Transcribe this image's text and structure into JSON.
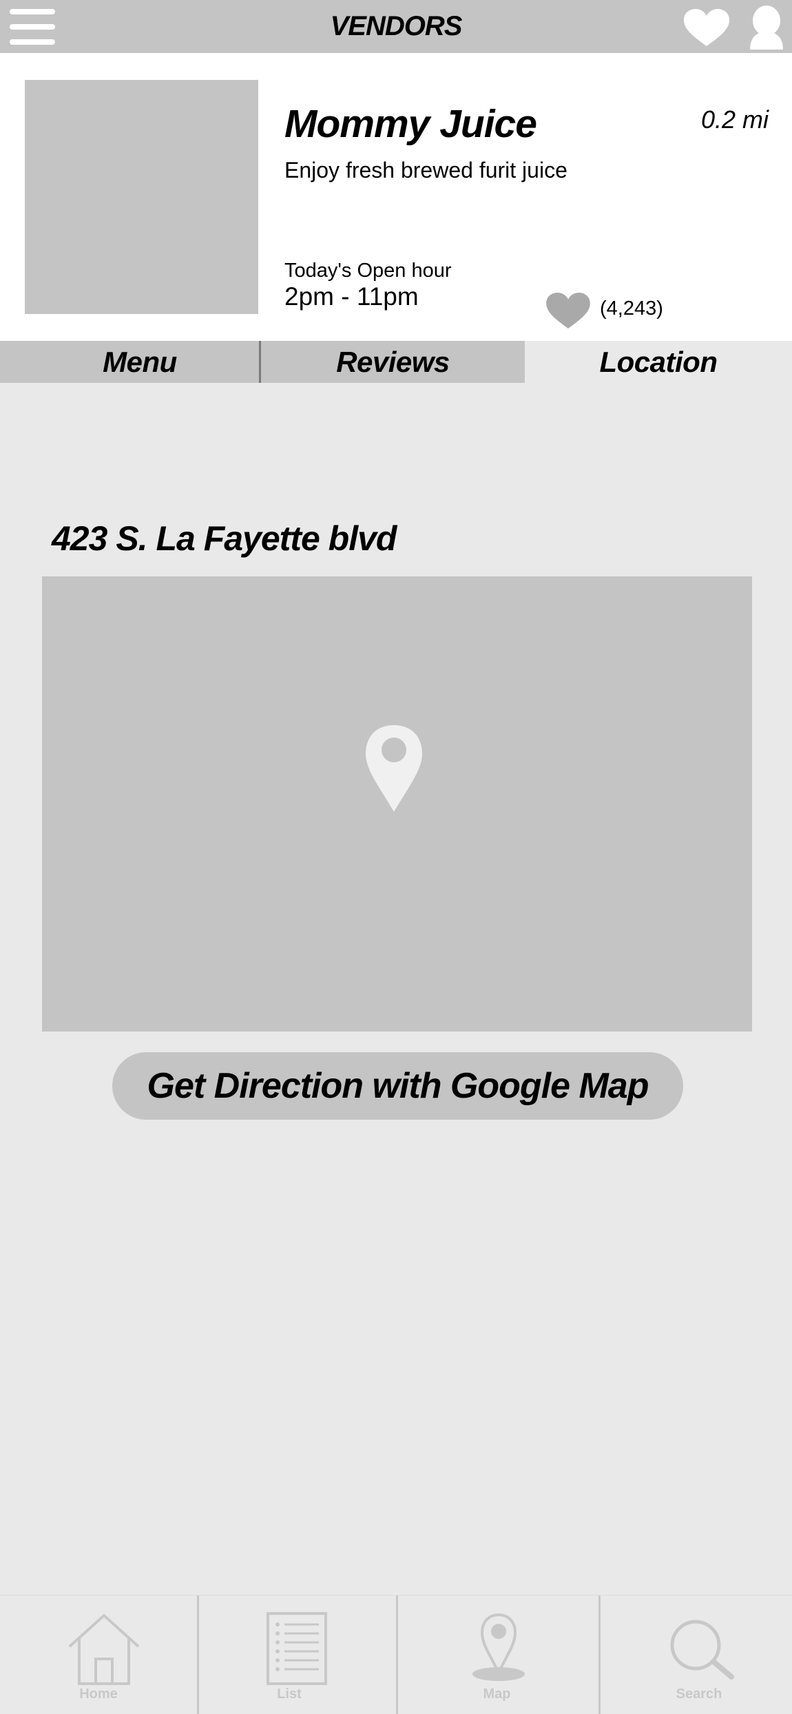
{
  "topbar": {
    "title": "VENDORS",
    "left_icon": "hamburger-menu-icon",
    "right_icons": [
      "heart-icon",
      "profile-icon"
    ]
  },
  "vendor": {
    "name": "Mommy Juice",
    "distance": "0.2 mi",
    "description": "Enjoy fresh brewed furit juice",
    "hours_label": "Today's Open hour",
    "hours": "2pm - 11pm",
    "like_count": "(4,243)"
  },
  "tabs": [
    {
      "label": "Menu",
      "active": false
    },
    {
      "label": "Reviews",
      "active": false
    },
    {
      "label": "Location",
      "active": true
    }
  ],
  "location": {
    "address": "423 S. La Fayette blvd",
    "map_icon": "map-pin-icon",
    "direction_button": "Get Direction with Google Map"
  },
  "bottom_nav": {
    "items": [
      {
        "label": "Home",
        "icon": "home-icon"
      },
      {
        "label": "List",
        "icon": "list-icon"
      },
      {
        "label": "Map",
        "icon": "map-pin-icon"
      },
      {
        "label": "Search",
        "icon": "search-icon"
      }
    ]
  },
  "colors": {
    "placeholder_gray": "#c4c4c4",
    "background": "#e9e9e9",
    "header_background": "#ffffff",
    "nav_inactive": "#c8c8c8",
    "heart_gray": "#a9a9a9"
  }
}
